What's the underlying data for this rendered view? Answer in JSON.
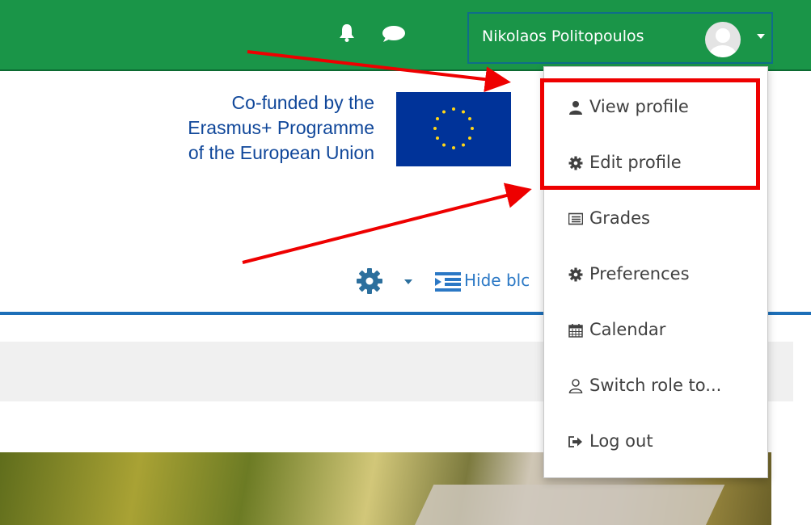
{
  "navbar": {
    "user_name": "Nikolaos Politopoulos",
    "bg_color": "#1a9548",
    "icons": [
      "bell-icon",
      "chat-bubble-icon"
    ]
  },
  "logo": {
    "lines": [
      "Co-funded by the",
      "Erasmus+ Programme",
      "of the European Union"
    ],
    "flag": "eu-flag"
  },
  "toolbar": {
    "hide_blocks_label": "Hide blc"
  },
  "user_dropdown": {
    "items": [
      {
        "label": "View profile",
        "icon": "user-icon"
      },
      {
        "label": "Edit profile",
        "icon": "cog-icon"
      },
      {
        "label": "Grades",
        "icon": "table-icon"
      },
      {
        "label": "Preferences",
        "icon": "cog-icon"
      },
      {
        "label": "Calendar",
        "icon": "calendar-icon"
      },
      {
        "label": "Switch role to...",
        "icon": "user-outline-icon"
      },
      {
        "label": "Log out",
        "icon": "sign-out-icon"
      }
    ]
  },
  "annotation_color": "#ee0000"
}
